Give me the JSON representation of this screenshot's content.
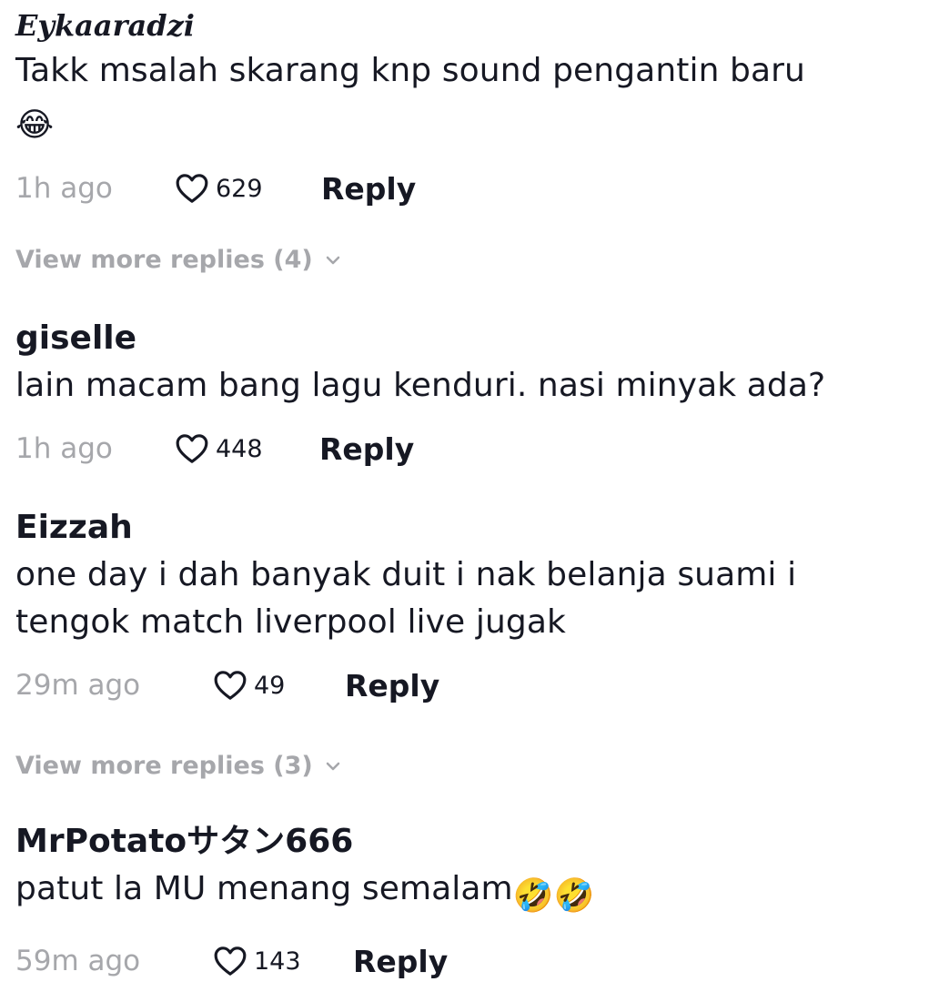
{
  "comments": [
    {
      "username": "Eykaaradzi",
      "text": "Takk msalah skarang knp sound pengantin baru",
      "emoji": "😂",
      "time": "1h ago",
      "likes": "629",
      "reply_label": "Reply"
    },
    {
      "username": "giselle",
      "text": "lain macam bang lagu kenduri. nasi minyak ada?",
      "time": "1h ago",
      "likes": "448",
      "reply_label": "Reply"
    },
    {
      "username": "Eizzah",
      "text": "one day i dah banyak duit i nak belanja suami i tengok match liverpool live jugak",
      "time": "29m ago",
      "likes": "49",
      "reply_label": "Reply"
    },
    {
      "username": "MrPotatoサタン666",
      "text": "patut la MU menang semalam",
      "emoji": "🤣🤣",
      "time": "59m ago",
      "likes": "143",
      "reply_label": "Reply"
    }
  ],
  "view_more": [
    "View more replies (4)",
    "View more replies (3)"
  ],
  "icons": {
    "like": "heart-outline-icon",
    "expand": "chevron-down-icon"
  },
  "colors": {
    "text": "#161823",
    "muted": "#a6a7ab"
  }
}
